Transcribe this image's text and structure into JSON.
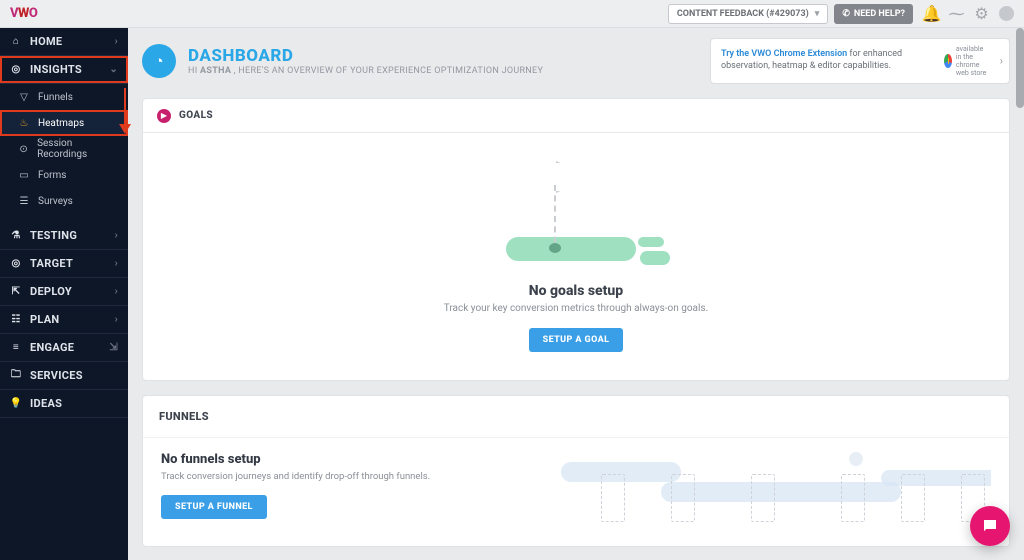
{
  "topbar": {
    "feedback_label": "CONTENT FEEDBACK (#429073)",
    "help_label": "NEED HELP?"
  },
  "dashboard": {
    "title": "DASHBOARD",
    "greeting_prefix": "HI ",
    "greeting_name": "ASTHA",
    "greeting_suffix": " , HERE'S AN OVERVIEW OF YOUR EXPERIENCE OPTIMIZATION JOURNEY"
  },
  "promo": {
    "link_text": "Try the VWO Chrome Extension",
    "rest": " for enhanced observation, heatmap & editor capabilities.",
    "badge_top": "available in the",
    "badge_bottom": "chrome web store"
  },
  "sidebar": {
    "home": "HOME",
    "insights": "INSIGHTS",
    "funnels": "Funnels",
    "heatmaps": "Heatmaps",
    "sessions": "Session Recordings",
    "forms": "Forms",
    "surveys": "Surveys",
    "testing": "TESTING",
    "target": "TARGET",
    "deploy": "DEPLOY",
    "plan": "PLAN",
    "engage": "ENGAGE",
    "services": "SERVICES",
    "ideas": "IDEAS"
  },
  "goals": {
    "section_title": "GOALS",
    "empty_heading": "No goals setup",
    "empty_sub": "Track your key conversion metrics through always-on goals.",
    "cta": "SETUP A GOAL"
  },
  "funnels": {
    "section_title": "FUNNELS",
    "empty_heading": "No funnels setup",
    "empty_sub": "Track conversion journeys and identify drop-off through funnels.",
    "cta": "SETUP A FUNNEL"
  }
}
